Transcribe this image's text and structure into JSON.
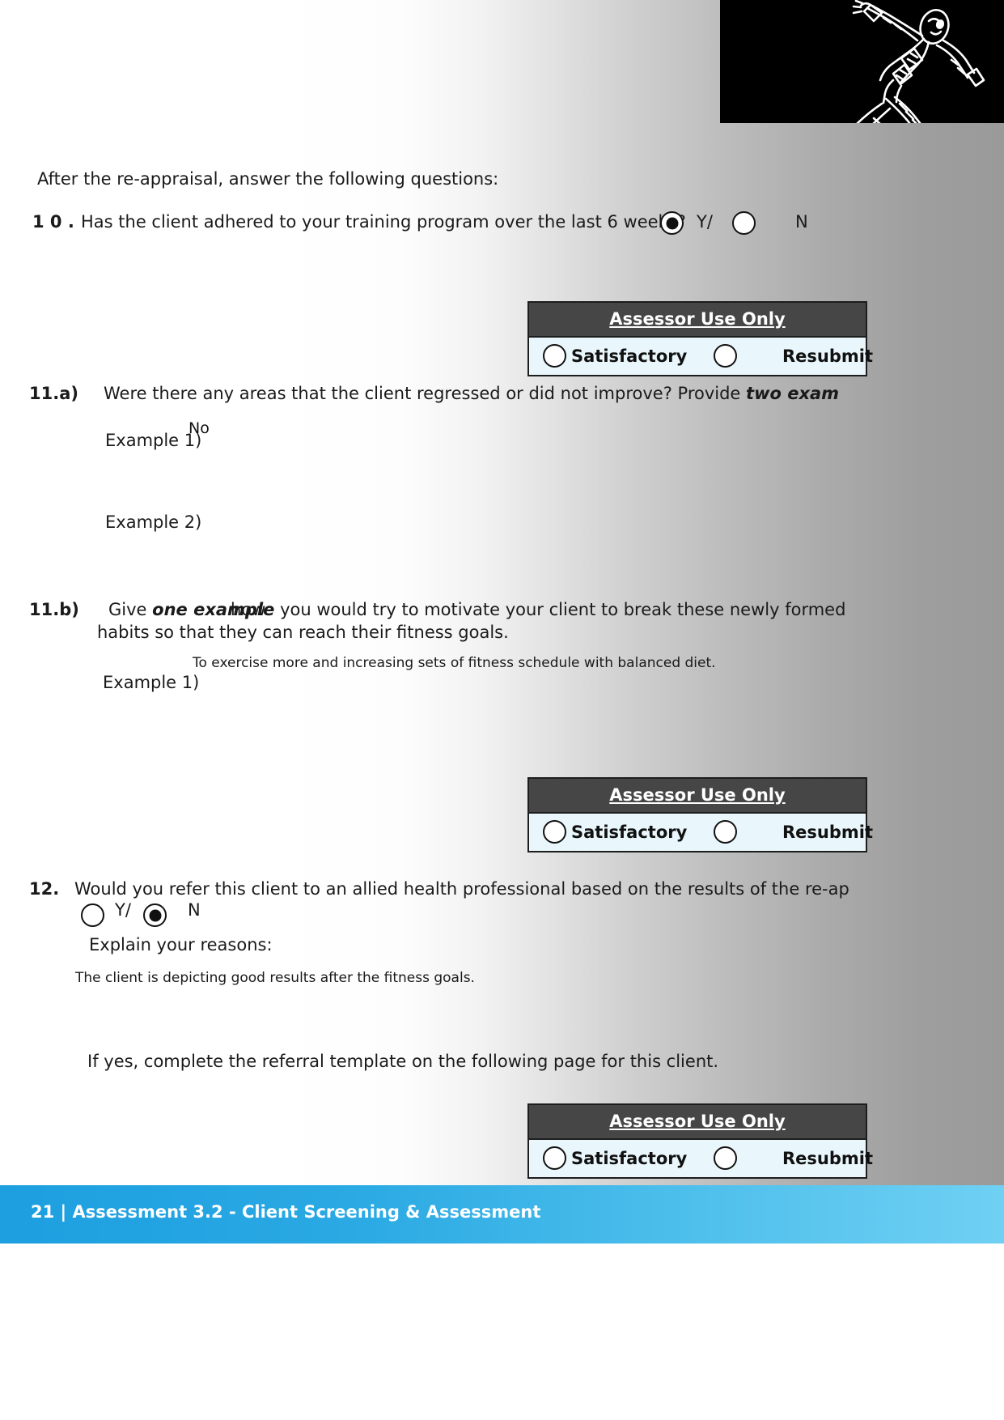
{
  "document": {
    "intro": "After the re-appraisal, answer the following questions:",
    "questions": [
      {
        "number": "1 0 .",
        "text": "Has the client adhered to your training program over the last 6 weeks?",
        "options": [
          {
            "label": "Y/",
            "selected": true
          },
          {
            "label": "N",
            "selected": false
          }
        ]
      },
      {
        "number": "11.a)",
        "text_part1": "Were there any areas that the client regressed or did not improve?  Provide ",
        "text_emphasis": "two exam",
        "examples": [
          {
            "label": "Example 1)",
            "answer": "No"
          },
          {
            "label": "Example 2)",
            "answer": ""
          }
        ]
      },
      {
        "number": "11.b)",
        "text_lead": "Give ",
        "text_emphasis": "one example",
        "text_overlap": "how",
        "text_rest": " you would try to motivate your client to break these newly formed",
        "text_line2": "habits so that they can reach their fitness goals.",
        "examples": [
          {
            "label": "Example 1)",
            "answer": "To exercise more and increasing sets of fitness schedule with balanced diet."
          }
        ]
      },
      {
        "number": "12",
        "number_suffix": ".",
        "text": "Would you refer this client to an allied health professional based on the results of the re-ap",
        "options": [
          {
            "label": "Y/",
            "selected": false
          },
          {
            "label": "N",
            "selected": true
          }
        ],
        "explain_prompt": "Explain your reasons:",
        "explain_answer": "The client is depicting good results after the fitness goals.",
        "note": "If yes, complete the referral template on the following page for this client."
      }
    ],
    "assessor_boxes": [
      {
        "title": "Assessor Use Only",
        "option_satisfactory": "Satisfactory",
        "option_resubmit": "Resubmit"
      },
      {
        "title": "Assessor Use Only",
        "option_satisfactory": "Satisfactory",
        "option_resubmit": "Resubmit"
      },
      {
        "title": "Assessor Use Only",
        "option_satisfactory": "Satisfactory",
        "option_resubmit": "Resubmit"
      }
    ],
    "footer": {
      "text": "21 | Assessment 3.2 - Client Screening & Assessment"
    },
    "logo": {
      "alt": "running-athlete-logo"
    }
  },
  "colors": {
    "assessor_header_bg": "#464646",
    "assessor_body_bg": "#e9f7fc",
    "footer_start": "#1d9fe0",
    "footer_end": "#6fd0f3",
    "text": "#1a1a1a"
  }
}
